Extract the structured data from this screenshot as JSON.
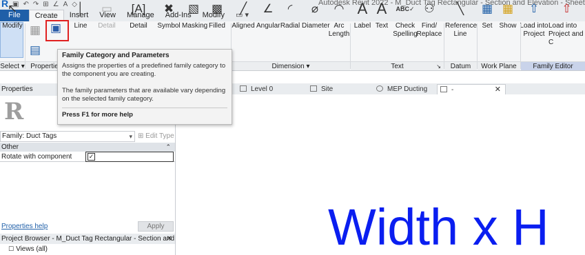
{
  "window": {
    "logo": "R",
    "title": "Autodesk Revit 2022 - M_Duct Tag Rectangular - Section and Elevation - Sheet: -"
  },
  "quick_access": [
    "▣",
    "↶",
    "↷",
    "⊞",
    "∠",
    "A",
    "◇"
  ],
  "ribbon_tabs": {
    "file": "File",
    "create": "Create",
    "insert": "Insert",
    "view": "View",
    "manage": "Manage",
    "addins": "Add-Ins",
    "modify": "Modify",
    "extra": "▭ ▾"
  },
  "ribbon": {
    "modify": {
      "label": "Modify"
    },
    "line": {
      "label": "Line"
    },
    "detail": {
      "label": "Detail"
    },
    "detail_group": {
      "label": "Detail"
    },
    "symbol": {
      "label": "Symbol"
    },
    "masking": {
      "label": "Masking"
    },
    "filled": {
      "label": "Filled"
    },
    "aligned": {
      "label": "Aligned"
    },
    "angular": {
      "label": "Angular"
    },
    "radial": {
      "label": "Radial"
    },
    "diameter": {
      "label": "Diameter"
    },
    "arc_length": {
      "label": "Arc\nLength"
    },
    "label": {
      "label": "Label"
    },
    "text": {
      "label": "Text"
    },
    "check_spelling": {
      "label": "Check\nSpelling"
    },
    "find_replace": {
      "label": "Find/\nReplace"
    },
    "reference_line": {
      "label": "Reference\nLine"
    },
    "set": {
      "label": "Set"
    },
    "show": {
      "label": "Show"
    },
    "load_into_project": {
      "label": "Load into\nProject"
    },
    "load_into_project_close": {
      "label": "Load into\nProject and C"
    }
  },
  "panels": {
    "select": "Select ▾",
    "properties": "Properties",
    "dimension": "Dimension ▾",
    "text": "Text",
    "text_arrow": "↘",
    "datum": "Datum",
    "work_plane": "Work Plane",
    "family_editor": "Family Editor"
  },
  "tooltip": {
    "title": "Family Category and Parameters",
    "line1": "Assigns the properties of a predefined family category to the component you are creating.",
    "line2": "The family parameters that are available vary depending on the selected family category.",
    "footer": "Press F1 for more help"
  },
  "properties": {
    "header": "Properties",
    "family_value": "Family: Duct Tags",
    "edit_type": "Edit Type",
    "group": "Other",
    "param_name": "Rotate with component",
    "param_checked": "✓",
    "help_link": "Properties help",
    "apply": "Apply"
  },
  "project_browser": {
    "header": "Project Browser - M_Duct Tag Rectangular - Section and Ele...",
    "close": "✕",
    "item": "Views (all)"
  },
  "view_tabs": [
    {
      "label": "Level 0"
    },
    {
      "label": "Site"
    },
    {
      "label": "MEP Ducting"
    },
    {
      "label": "-"
    }
  ],
  "view_tab_close": "✕",
  "canvas": {
    "text": "Width x H"
  }
}
